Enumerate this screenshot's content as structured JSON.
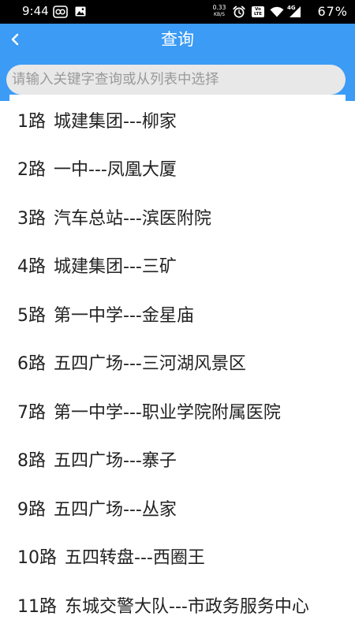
{
  "status_bar": {
    "time": "9:44",
    "net_speed": {
      "value": "0.33",
      "unit": "KB/S"
    },
    "volte": {
      "top": "Vo",
      "bottom": "LTE"
    },
    "network_type": "4G",
    "battery_percent": "67%",
    "left_icons": [
      "app-notification-icon",
      "image-notification-icon"
    ],
    "right_icons": [
      "alarm-icon",
      "volte-icon",
      "wifi-icon",
      "cell-signal-icon"
    ]
  },
  "header": {
    "back_icon": "chevron-left-icon",
    "title": "查询"
  },
  "search": {
    "placeholder": "请输入关键字查询或从列表中选择"
  },
  "routes": [
    {
      "route": "1路",
      "line": "城建集团---柳家"
    },
    {
      "route": "2路",
      "line": "一中---凤凰大厦"
    },
    {
      "route": "3路",
      "line": "汽车总站---滨医附院"
    },
    {
      "route": "4路",
      "line": "城建集团---三矿"
    },
    {
      "route": "5路",
      "line": "第一中学---金星庙"
    },
    {
      "route": "6路",
      "line": "五四广场---三河湖风景区"
    },
    {
      "route": "7路",
      "line": "第一中学---职业学院附属医院"
    },
    {
      "route": "8路",
      "line": "五四广场---寨子"
    },
    {
      "route": "9路",
      "line": "五四广场---丛家"
    },
    {
      "route": "10路",
      "line": "五四转盘---西圈王"
    },
    {
      "route": "11路",
      "line": "东城交警大队---市政务服务中心"
    }
  ],
  "colors": {
    "status_bar_bg": "#000000",
    "header_bg": "#3b9bf5",
    "search_bg": "#e8e8e8",
    "placeholder": "#9a9a9a",
    "list_bg": "#ffffff",
    "list_text": "#222222"
  }
}
